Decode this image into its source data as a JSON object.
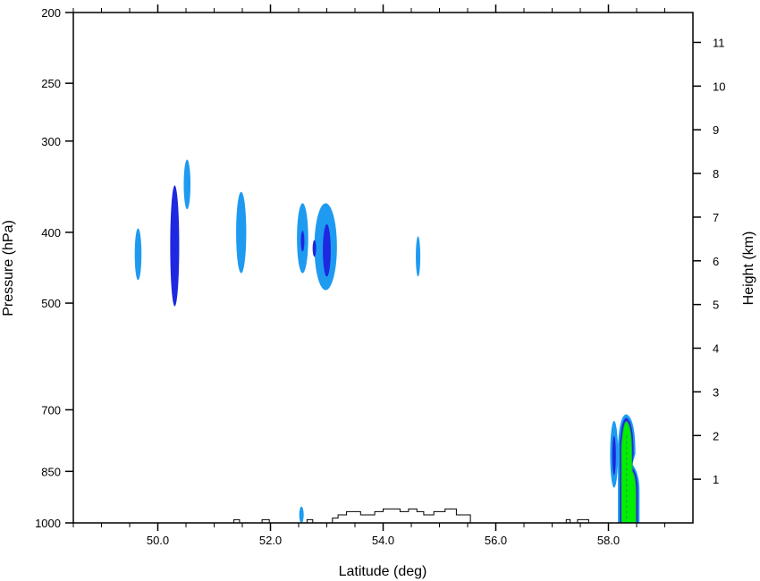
{
  "chart_data": {
    "type": "contour",
    "xlabel": "Latitude (deg)",
    "ylabel_left": "Pressure (hPa)",
    "ylabel_right": "Height (km)",
    "xlim": [
      48.5,
      59.5
    ],
    "x_ticks": [
      50.0,
      52.0,
      54.0,
      56.0,
      58.0
    ],
    "x_tick_labels": [
      "50.0",
      "52.0",
      "54.0",
      "56.0",
      "58.0"
    ],
    "x_minor_ticks": [
      48.5,
      49.0,
      49.5,
      50.5,
      51.0,
      51.5,
      52.5,
      53.0,
      53.5,
      54.5,
      55.0,
      55.5,
      56.5,
      57.0,
      57.5,
      58.5,
      59.0
    ],
    "pressure_axis": {
      "scale": "log",
      "range_hpa": [
        200,
        1000
      ],
      "ticks": [
        200,
        250,
        300,
        400,
        500,
        700,
        850,
        1000
      ],
      "tick_labels": [
        "200",
        "250",
        "300",
        "400",
        "500",
        "700",
        "850",
        "1000"
      ]
    },
    "height_axis": {
      "ticks": [
        1,
        2,
        3,
        4,
        5,
        6,
        7,
        8,
        9,
        10,
        11
      ],
      "tick_labels": [
        "1",
        "2",
        "3",
        "4",
        "5",
        "6",
        "7",
        "8",
        "9",
        "10",
        "11"
      ]
    },
    "colors": {
      "level1": "#1E9BF0",
      "level2": "#1E28E0",
      "level3": "#00F000",
      "level3_edge": "#28A050",
      "terrain": "#000000"
    },
    "features": [
      {
        "lat": 49.65,
        "p_top": 395,
        "p_bottom": 465,
        "lat_halfwidth": 0.06,
        "level": 1
      },
      {
        "lat": 50.3,
        "p_top": 345,
        "p_bottom": 505,
        "lat_halfwidth": 0.08,
        "level": 2
      },
      {
        "lat": 50.52,
        "p_top": 318,
        "p_bottom": 372,
        "lat_halfwidth": 0.06,
        "level": 1
      },
      {
        "lat": 51.48,
        "p_top": 352,
        "p_bottom": 455,
        "lat_halfwidth": 0.09,
        "level": 1
      },
      {
        "lat": 52.57,
        "p_top": 365,
        "p_bottom": 455,
        "lat_halfwidth": 0.1,
        "level": 1
      },
      {
        "lat": 52.57,
        "p_top": 398,
        "p_bottom": 425,
        "lat_halfwidth": 0.03,
        "level": 2
      },
      {
        "lat": 52.98,
        "p_top": 365,
        "p_bottom": 480,
        "lat_halfwidth": 0.2,
        "level": 1
      },
      {
        "lat": 53.0,
        "p_top": 390,
        "p_bottom": 460,
        "lat_halfwidth": 0.07,
        "level": 2
      },
      {
        "lat": 52.78,
        "p_top": 410,
        "p_bottom": 432,
        "lat_halfwidth": 0.03,
        "level": 2
      },
      {
        "lat": 54.62,
        "p_top": 405,
        "p_bottom": 460,
        "lat_halfwidth": 0.04,
        "level": 1
      },
      {
        "lat": 52.55,
        "p_top": 950,
        "p_bottom": 1000,
        "lat_halfwidth": 0.04,
        "level": 1
      },
      {
        "lat": 58.1,
        "p_top": 725,
        "p_bottom": 895,
        "lat_halfwidth": 0.07,
        "level": 1
      },
      {
        "lat": 58.1,
        "p_top": 760,
        "p_bottom": 860,
        "lat_halfwidth": 0.03,
        "level": 2
      }
    ],
    "intense_cell": {
      "lat_left": 58.2,
      "lat_peak": 58.32,
      "lat_right": 58.52,
      "p_top": 718,
      "p_shoulder": 855,
      "p_bottom": 1000,
      "level": 3
    },
    "terrain_profile_hpa": [
      [
        51.35,
        1000
      ],
      [
        51.35,
        990
      ],
      [
        51.45,
        990
      ],
      [
        51.45,
        1000
      ],
      [
        51.85,
        1000
      ],
      [
        51.85,
        990
      ],
      [
        51.98,
        990
      ],
      [
        51.98,
        1000
      ],
      [
        52.65,
        1000
      ],
      [
        52.65,
        990
      ],
      [
        52.75,
        990
      ],
      [
        52.75,
        1000
      ],
      [
        53.1,
        1000
      ],
      [
        53.1,
        985
      ],
      [
        53.2,
        985
      ],
      [
        53.2,
        975
      ],
      [
        53.35,
        975
      ],
      [
        53.35,
        965
      ],
      [
        53.6,
        965
      ],
      [
        53.6,
        975
      ],
      [
        53.85,
        975
      ],
      [
        53.85,
        965
      ],
      [
        54.0,
        965
      ],
      [
        54.0,
        957
      ],
      [
        54.3,
        957
      ],
      [
        54.3,
        965
      ],
      [
        54.45,
        965
      ],
      [
        54.45,
        957
      ],
      [
        54.6,
        957
      ],
      [
        54.6,
        965
      ],
      [
        54.72,
        965
      ],
      [
        54.72,
        975
      ],
      [
        54.9,
        975
      ],
      [
        54.9,
        965
      ],
      [
        55.1,
        965
      ],
      [
        55.1,
        957
      ],
      [
        55.3,
        957
      ],
      [
        55.3,
        975
      ],
      [
        55.55,
        975
      ],
      [
        55.55,
        1000
      ],
      [
        57.25,
        1000
      ],
      [
        57.25,
        990
      ],
      [
        57.32,
        990
      ],
      [
        57.32,
        1000
      ],
      [
        57.45,
        1000
      ],
      [
        57.45,
        990
      ],
      [
        57.65,
        990
      ],
      [
        57.65,
        1000
      ]
    ]
  }
}
